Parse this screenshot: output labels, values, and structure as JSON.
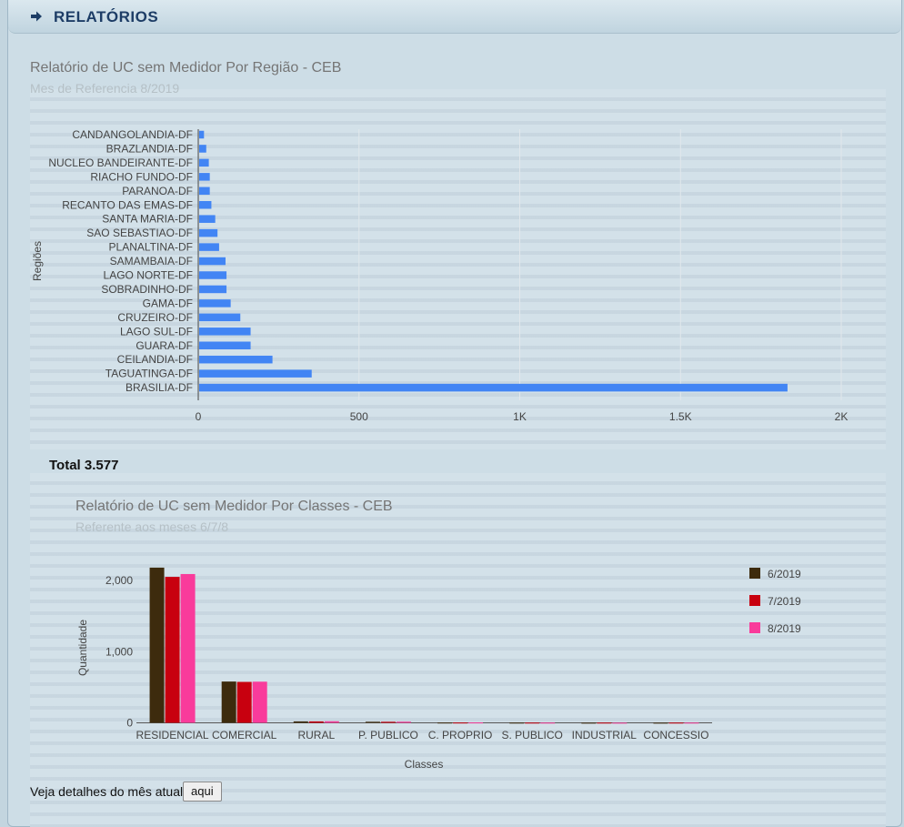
{
  "header": {
    "title": "RELATÓRIOS",
    "icon": "arrow-right-icon"
  },
  "total": {
    "text": "Total 3.577"
  },
  "footer": {
    "text": "Veja detalhes do mês atual",
    "button_label": "aqui"
  },
  "chart_data": [
    {
      "type": "bar",
      "orientation": "horizontal",
      "title": "Relatório de UC sem Medidor Por Região - CEB",
      "subtitle": "Mes de Referencia 8/2019",
      "ylabel": "Regiões",
      "xlabel": "",
      "categories": [
        "CANDANGOLANDIA-DF",
        "BRAZLANDIA-DF",
        "NUCLEO BANDEIRANTE-DF",
        "RIACHO FUNDO-DF",
        "PARANOA-DF",
        "RECANTO DAS EMAS-DF",
        "SANTA MARIA-DF",
        "SAO SEBASTIAO-DF",
        "PLANALTINA-DF",
        "SAMAMBAIA-DF",
        "LAGO NORTE-DF",
        "SOBRADINHO-DF",
        "GAMA-DF",
        "CRUZEIRO-DF",
        "LAGO SUL-DF",
        "GUARA-DF",
        "CEILANDIA-DF",
        "TAGUATINGA-DF",
        "BRASILIA-DF"
      ],
      "values": [
        15,
        22,
        30,
        33,
        33,
        38,
        50,
        57,
        62,
        82,
        85,
        85,
        98,
        128,
        160,
        160,
        228,
        350,
        1830
      ],
      "xlim": [
        0,
        2000
      ],
      "xticks": [
        0,
        500,
        1000,
        1500,
        2000
      ],
      "xtick_labels": [
        "0",
        "500",
        "1K",
        "1.5K",
        "2K"
      ],
      "color": "#4285f4",
      "grid": true
    },
    {
      "type": "bar",
      "title": "Relatório de UC sem Medidor Por Classes - CEB",
      "subtitle": "Referente aos meses 6/7/8",
      "xlabel": "Classes",
      "ylabel": "Quantidade",
      "categories": [
        "RESIDENCIAL",
        "COMERCIAL",
        "RURAL",
        "P. PUBLICO",
        "C. PROPRIO",
        "S. PUBLICO",
        "INDUSTRIAL",
        "CONCESSIO"
      ],
      "series": [
        {
          "name": "6/2019",
          "color": "#3d2b0d",
          "values": [
            2180,
            580,
            20,
            15,
            4,
            3,
            2,
            2
          ]
        },
        {
          "name": "7/2019",
          "color": "#c8000f",
          "values": [
            2050,
            575,
            20,
            15,
            4,
            3,
            3,
            3
          ]
        },
        {
          "name": "8/2019",
          "color": "#f93b9b",
          "values": [
            2090,
            578,
            22,
            16,
            5,
            3,
            2,
            3
          ]
        }
      ],
      "ylim": [
        0,
        2200
      ],
      "yticks": [
        0,
        1000,
        2000
      ],
      "ytick_labels": [
        "0",
        "1,000",
        "2,000"
      ],
      "legend": "right",
      "grid": false
    }
  ]
}
